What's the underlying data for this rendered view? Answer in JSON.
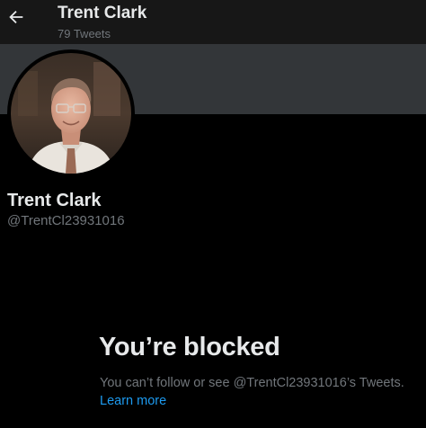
{
  "header": {
    "name": "Trent Clark",
    "tweet_count": "79 Tweets",
    "back_icon": "arrow-left-icon"
  },
  "profile": {
    "name": "Trent Clark",
    "handle": "@TrentCl23931016",
    "banner_color": "#333639"
  },
  "blocked": {
    "title": "You’re blocked",
    "description": "You can’t follow or see @TrentCl23931016’s Tweets.",
    "link_label": "Learn more"
  },
  "colors": {
    "background": "#000000",
    "header_bg": "#171717",
    "primary_text": "#e7e9ea",
    "secondary_text": "#71767b",
    "link": "#1d9bf0"
  }
}
